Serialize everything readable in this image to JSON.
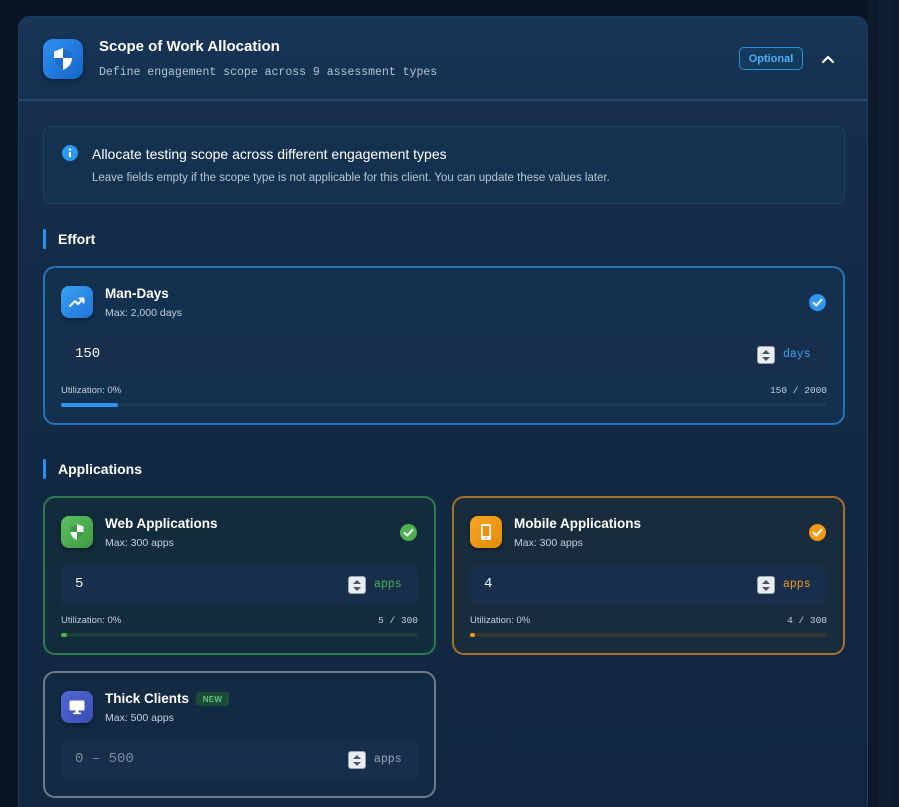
{
  "header": {
    "title": "Scope of Work Allocation",
    "subtitle": "Define engagement scope across 9 assessment types",
    "badge": "Optional",
    "shield_icon": "shield-icon",
    "collapse_icon": "chevron-up-icon"
  },
  "info": {
    "title": "Allocate testing scope across different engagement types",
    "description": "Leave fields empty if the scope type is not applicable for this client. You can update these values later.",
    "icon": "info-icon"
  },
  "sections": {
    "effort": "Effort",
    "applications": "Applications"
  },
  "cards": {
    "man_days": {
      "title": "Man-Days",
      "max": "Max: 2,000 days",
      "value": "150",
      "unit": "days",
      "utilization": "Utilization: 0%",
      "count": "150 / 2000",
      "fill_fraction": 0.075,
      "accent": "#2f95f0",
      "icon": "trending-up-icon",
      "checked": true
    },
    "web_apps": {
      "title": "Web Applications",
      "max": "Max: 300 apps",
      "value": "5",
      "unit": "apps",
      "utilization": "Utilization: 0%",
      "count": "5 / 300",
      "fill_fraction": 0.017,
      "accent": "#4caf50",
      "icon": "shield-check-icon",
      "checked": true
    },
    "mobile_apps": {
      "title": "Mobile Applications",
      "max": "Max: 300 apps",
      "value": "4",
      "unit": "apps",
      "utilization": "Utilization: 0%",
      "count": "4 / 300",
      "fill_fraction": 0.013,
      "accent": "#f29a18",
      "icon": "smartphone-icon",
      "checked": true
    },
    "thick_clients": {
      "title": "Thick Clients",
      "badge": "NEW",
      "max": "Max: 500 apps",
      "placeholder": "0 – 500",
      "unit": "apps",
      "accent": "#4a5ec8",
      "icon": "monitor-icon",
      "checked": false
    }
  }
}
